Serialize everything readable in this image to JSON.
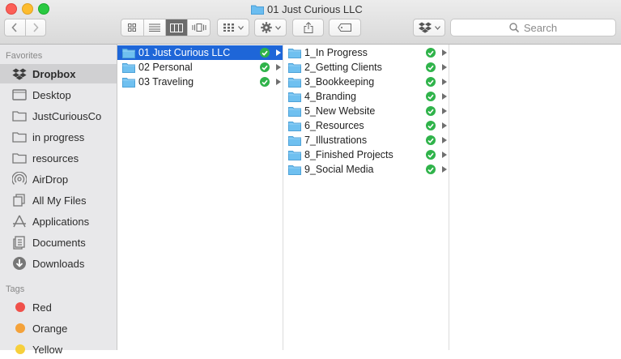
{
  "window": {
    "title": "01 Just Curious LLC"
  },
  "toolbar": {
    "search_placeholder": "Search",
    "icons": [
      "chevron-left-icon",
      "chevron-right-icon",
      "icon-view-icon",
      "list-view-icon",
      "column-view-icon",
      "cover-flow-icon",
      "arrange-icon",
      "gear-icon",
      "share-icon",
      "tag-icon",
      "dropbox-icon",
      "search-icon"
    ]
  },
  "sidebar": {
    "favorites_heading": "Favorites",
    "favorites": [
      {
        "label": "Dropbox",
        "icon": "dropbox-icon"
      },
      {
        "label": "Desktop",
        "icon": "desktop-icon"
      },
      {
        "label": "JustCuriousCo",
        "icon": "folder-icon"
      },
      {
        "label": "in progress",
        "icon": "folder-icon"
      },
      {
        "label": "resources",
        "icon": "folder-icon"
      },
      {
        "label": "AirDrop",
        "icon": "airdrop-icon"
      },
      {
        "label": "All My Files",
        "icon": "files-icon"
      },
      {
        "label": "Applications",
        "icon": "applications-icon"
      },
      {
        "label": "Documents",
        "icon": "documents-icon"
      },
      {
        "label": "Downloads",
        "icon": "downloads-icon"
      }
    ],
    "tags_heading": "Tags",
    "tags": [
      {
        "label": "Red",
        "color": "#f0504a"
      },
      {
        "label": "Orange",
        "color": "#f4a23a"
      },
      {
        "label": "Yellow",
        "color": "#f6cf3c"
      }
    ]
  },
  "columns": [
    {
      "items": [
        {
          "label": "01 Just Curious LLC",
          "selected": true
        },
        {
          "label": "02 Personal",
          "selected": false
        },
        {
          "label": "03 Traveling",
          "selected": false
        }
      ]
    },
    {
      "items": [
        {
          "label": "1_In Progress"
        },
        {
          "label": "2_Getting Clients"
        },
        {
          "label": "3_Bookkeeping"
        },
        {
          "label": "4_Branding"
        },
        {
          "label": "5_New Website"
        },
        {
          "label": "6_Resources"
        },
        {
          "label": "7_Illustrations"
        },
        {
          "label": "8_Finished Projects"
        },
        {
          "label": "9_Social Media"
        }
      ]
    }
  ],
  "colors": {
    "selection": "#1e66d8",
    "sync_ok": "#2fb34a",
    "folder": "#5ab4ea"
  }
}
